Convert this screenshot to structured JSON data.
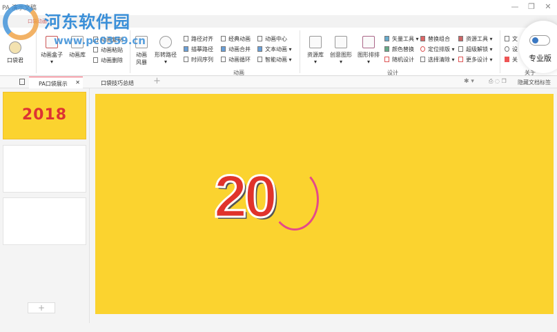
{
  "window": {
    "title": "PA 演示文稿",
    "min": "—",
    "max": "❐",
    "close": "✕"
  },
  "watermark": {
    "name": "河东软件园",
    "url": "www.pc0359.cn"
  },
  "ribbon_tab": "口袋动画",
  "ribbon": {
    "pocket": "口袋君",
    "anim_box": "动画盒子",
    "anim_lib": "动画库",
    "anim_copy": "动画复制",
    "anim_paste": "动画粘贴",
    "anim_delete": "动画删除",
    "anim_storm": "动画风暴",
    "shape_path": "形转路径",
    "path_align": "路径对齐",
    "trace_path": "描摹路径",
    "timeline": "时间序列",
    "classic": "经典动画",
    "merge": "动画合并",
    "loop": "动画循环",
    "center": "动画中心",
    "text_anim": "文本动画",
    "smart_anim": "智能动画",
    "group_anim": "动画",
    "resource_lib": "资源库",
    "creative_shape": "创意图形",
    "shape_arrange": "图形排排",
    "vector": "矢量工具",
    "color_replace": "颜色替换",
    "random": "随机设计",
    "replace_group": "替换组合",
    "position": "定位排版",
    "select_clear": "选择清除",
    "res_tools": "资源工具",
    "unlock": "超级解锁",
    "more_design": "更多设计",
    "group_design": "设计",
    "about1": "文",
    "about2": "设",
    "about3": "关",
    "group_about": "关于",
    "pro": "专业版"
  },
  "doc_tabs": [
    {
      "label": "PA口袋展示",
      "active": true
    },
    {
      "label": "口袋技巧总结",
      "active": false
    }
  ],
  "doc_tab_add": "+",
  "hide_tabs": "隐藏文档标签",
  "slides": [
    {
      "text": "2018"
    },
    {
      "text": ""
    },
    {
      "text": ""
    }
  ],
  "slide_main": {
    "text": "20",
    "background": "#fbd32f"
  }
}
